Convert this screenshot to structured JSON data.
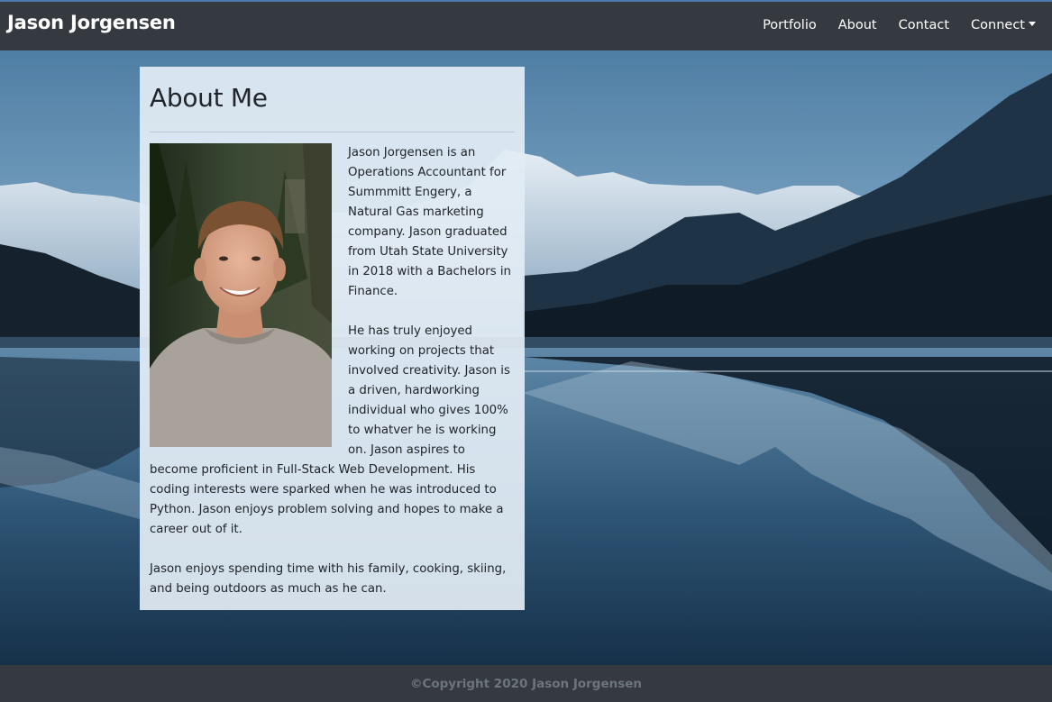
{
  "navbar": {
    "brand": "Jason Jorgensen",
    "links": [
      {
        "label": "Portfolio"
      },
      {
        "label": "About"
      },
      {
        "label": "Contact"
      },
      {
        "label": "Connect"
      }
    ]
  },
  "about": {
    "heading": "About Me",
    "paragraphs": [
      "Jason Jorgensen is an Operations Accountant for Summmitt Engery, a Natural Gas marketing company. Jason graduated from Utah State University in 2018 with a Bachelors in Finance.",
      "He has truly enjoyed working on projects that involved creativity. Jason is a driven, hardworking individual who gives 100% to whatver he is working on. Jason aspires to become proficient in Full-Stack Web Development. His coding interests were sparked when he was introduced to Python. Jason enjoys problem solving and hopes to make a career out of it.",
      "Jason enjoys spending time with his family, cooking, skiing, and being outdoors as much as he can."
    ]
  },
  "footer": {
    "copyright": "©Copyright 2020 Jason Jorgensen"
  },
  "colors": {
    "navbar": "#343a40",
    "footer": "#343a40",
    "footer_text": "#6c757d",
    "card": "#e2ecf4"
  },
  "icons": {
    "dropdown": "caret-down-icon"
  }
}
